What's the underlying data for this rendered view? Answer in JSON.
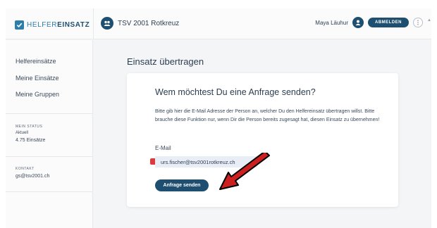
{
  "brand": {
    "prefix": "HELFER",
    "suffix": "EINSATZ",
    "color": "#2d7ea9"
  },
  "header": {
    "org_name": "TSV 2001 Rotkreuz",
    "user_name": "Maya Läuhur",
    "logout_label": "ABMELDEN",
    "icons": [
      "team-icon",
      "user-icon",
      "more-icon"
    ]
  },
  "sidebar": {
    "items": [
      {
        "label": "Helfereinsätze"
      },
      {
        "label": "Meine Einsätze"
      },
      {
        "label": "Meine Gruppen"
      }
    ],
    "status": {
      "heading": "MEIN STATUS",
      "label": "Aktuell",
      "value": "4.75 Einsätze"
    },
    "contact": {
      "heading": "KONTAKT",
      "email": "gs@tsv2001.ch"
    }
  },
  "main": {
    "title": "Einsatz übertragen",
    "card": {
      "title": "Wem möchtest Du eine Anfrage senden?",
      "description": "Bitte gib hier die E-Mail Adresse der Person an, welcher Du den Helfereinsatz übertragen willst. Bitte brauche diese Funktion nur, wenn Dir die Person bereits zugesagt hat, diesen Einsatz zu übernehmen!",
      "email_label": "E-Mail",
      "email_value": "urs.fischer@tsv2001rotkreuz.ch",
      "send_label": "Anfrage senden"
    }
  },
  "colors": {
    "primary": "#1f4f70",
    "annotation_arrow": "#cc1f1f"
  }
}
